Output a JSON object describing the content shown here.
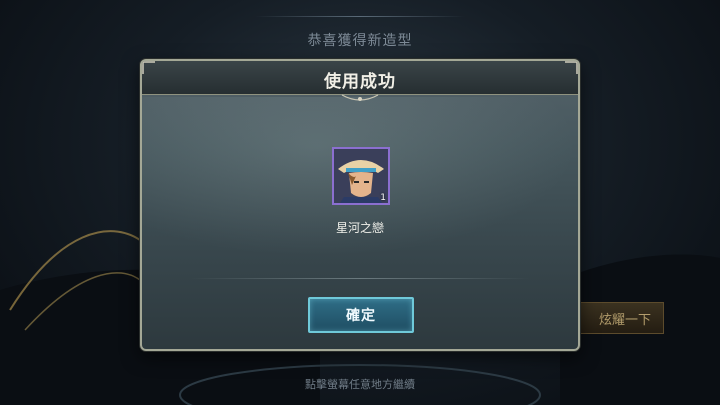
{
  "background": {
    "congrats_text": "恭喜獲得新造型",
    "show_off_button_label": "炫耀一下",
    "tap_hint": "點擊螢幕任意地方繼續"
  },
  "dialog": {
    "title": "使用成功",
    "item": {
      "name": "星河之戀",
      "count": "1",
      "icon": "hero-skin-portrait-icon"
    },
    "confirm_label": "確定"
  },
  "colors": {
    "confirm_border": "#6fc9d9",
    "confirm_fill": "#2f6e86",
    "item_frame": "#8b6fd0",
    "show_off_text": "#b39d6c"
  }
}
